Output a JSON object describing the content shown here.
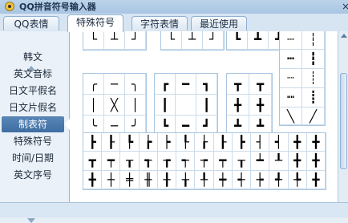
{
  "window": {
    "title": "QQ拼音符号输入器",
    "close_glyph": "×"
  },
  "tabs": [
    {
      "label": "QQ表情"
    },
    {
      "label": "特殊符号"
    },
    {
      "label": "字符表情"
    },
    {
      "label": "最近使用"
    }
  ],
  "active_tab": 1,
  "sidebar": {
    "items": [
      {
        "label": "韩文"
      },
      {
        "label": "英文音标"
      },
      {
        "label": "日文平假名"
      },
      {
        "label": "日文片假名"
      },
      {
        "label": "制表符"
      },
      {
        "label": "特殊符号"
      },
      {
        "label": "时间/日期"
      },
      {
        "label": "英文序号"
      }
    ],
    "selected_index": 4
  },
  "content": {
    "top_partial_row": [
      "└",
      "┴",
      "┘",
      "└",
      "┴",
      "┘",
      "┗",
      "┻",
      "┛"
    ],
    "dots_group": [
      "┄",
      "┆",
      "┅",
      "┇",
      "┈",
      "┊",
      "┉",
      "┋",
      "╲",
      "╱"
    ],
    "box_group_1": [
      "╭",
      "─",
      "╮",
      "│",
      "╳",
      "│",
      "╰",
      "─",
      "╯"
    ],
    "box_group_2": [
      "┏",
      "━",
      "┓",
      "┃",
      "",
      "┃",
      "┗",
      "━",
      "┛"
    ],
    "box_group_3": [
      "┳",
      "┳",
      "╋",
      "╋",
      "┻",
      "┻"
    ],
    "bottom_grid": [
      "┣",
      "┠",
      "┡",
      "┢",
      "┝",
      "┞",
      "┟",
      "┠",
      "┣",
      "┤",
      "┥",
      "╋",
      "╋",
      "┳",
      "┯",
      "┰",
      "┱",
      "┲",
      "┭",
      "┮",
      "┯",
      "┰",
      "┷",
      "┸",
      "╋",
      "╋",
      "╋",
      "┼",
      "╪",
      "╫",
      "╂",
      "╁",
      "╀",
      "┿",
      "┽",
      "┾",
      "╃",
      "╄",
      "╋"
    ]
  }
}
